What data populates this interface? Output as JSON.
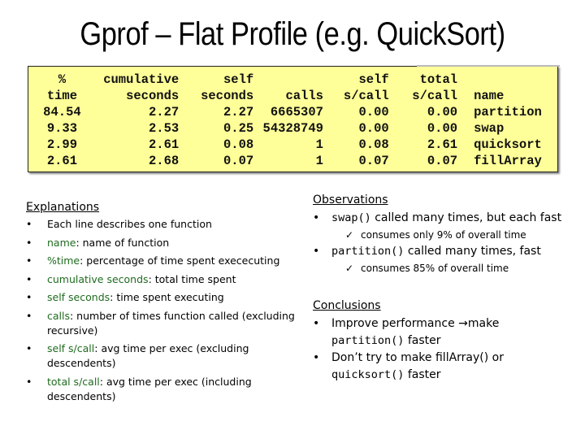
{
  "title": "Gprof – Flat Profile (e.g. QuickSort)",
  "profile": {
    "header_rows": [
      [
        "%",
        "cumulative",
        "self",
        "",
        "self",
        "total",
        ""
      ],
      [
        "time",
        "seconds",
        "seconds",
        "calls",
        "s/call",
        "s/call",
        "name"
      ]
    ],
    "rows": [
      [
        "84.54",
        "2.27",
        "2.27",
        "6665307",
        "0.00",
        "0.00",
        "partition"
      ],
      [
        "9.33",
        "2.53",
        "0.25",
        "54328749",
        "0.00",
        "0.00",
        "swap"
      ],
      [
        "2.99",
        "2.61",
        "0.08",
        "1",
        "0.08",
        "2.61",
        "quicksort"
      ],
      [
        "2.61",
        "2.68",
        "0.07",
        "1",
        "0.07",
        "0.07",
        "fillArray"
      ]
    ],
    "background_color": "#ffff99"
  },
  "explanations": {
    "heading": "Explanations",
    "bullet": "•",
    "term_color": "#1f6b1f",
    "items": [
      {
        "term": "",
        "text": "Each line describes one function"
      },
      {
        "term": "name",
        "text": ": name of function"
      },
      {
        "term": "%time",
        "text": ": percentage of time spent exececuting"
      },
      {
        "term": "cumulative seconds",
        "text": ": total time spent"
      },
      {
        "term": "self seconds",
        "text": ": time spent executing"
      },
      {
        "term": "calls",
        "text": ": number of times function called (excluding recursive)"
      },
      {
        "term": "self s/call",
        "text": ": avg time per exec (excluding descendents)"
      },
      {
        "term": "total s/call",
        "text": ": avg time per exec (including descendents)"
      }
    ]
  },
  "observations": {
    "heading": "Observations",
    "bullet": "•",
    "check": "✓",
    "items": [
      {
        "code": "swap()",
        "text": " called many times, but each fast",
        "sub": "consumes only 9% of overall time"
      },
      {
        "code": "partition()",
        "text": " called many times, fast",
        "sub": "consumes 85% of overall time"
      }
    ]
  },
  "conclusions": {
    "heading": "Conclusions",
    "bullet": "•",
    "items": [
      {
        "pre": "Improve performance ",
        "arrow": "→",
        "mid": "make ",
        "code": "partition()",
        "post": " faster"
      },
      {
        "pre": "Don’t try to make fillArray() or ",
        "code": "quicksort()",
        "post": " faster"
      }
    ]
  }
}
